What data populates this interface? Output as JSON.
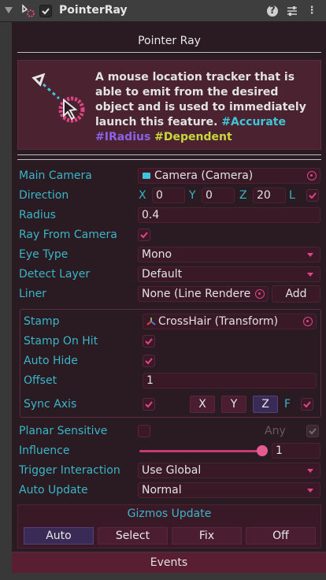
{
  "header": {
    "title": "PointerRay"
  },
  "panel_title": "Pointer Ray",
  "description": {
    "text": "A mouse location tracker that is able to emit from the desired object and is used to immediately launch this feature.",
    "tag_accurate": "#Accurate",
    "tag_iradius": "#IRadius",
    "tag_dependent": "#Dependent"
  },
  "fields": {
    "main_camera": {
      "label": "Main Camera",
      "value": "Camera (Camera)"
    },
    "direction": {
      "label": "Direction",
      "x_label": "X",
      "x": "0",
      "y_label": "Y",
      "y": "0",
      "z_label": "Z",
      "z": "20",
      "l_label": "L"
    },
    "radius": {
      "label": "Radius",
      "value": "0.4"
    },
    "ray_from_camera": {
      "label": "Ray From Camera"
    },
    "eye_type": {
      "label": "Eye Type",
      "value": "Mono"
    },
    "detect_layer": {
      "label": "Detect Layer",
      "value": "Default"
    },
    "liner": {
      "label": "Liner",
      "value": "None (Line Rendere",
      "add_label": "Add"
    },
    "stamp": {
      "label": "Stamp",
      "value": "CrossHair (Transform)"
    },
    "stamp_on_hit": {
      "label": "Stamp On Hit"
    },
    "auto_hide": {
      "label": "Auto Hide"
    },
    "offset": {
      "label": "Offset",
      "value": "1"
    },
    "sync_axis": {
      "label": "Sync Axis",
      "x": "X",
      "y": "Y",
      "z": "Z",
      "f": "F"
    },
    "planar_sensitive": {
      "label": "Planar Sensitive",
      "any_label": "Any"
    },
    "influence": {
      "label": "Influence",
      "value": "1",
      "slider_fraction": 1.0
    },
    "trigger_interaction": {
      "label": "Trigger Interaction",
      "value": "Use Global"
    },
    "auto_update": {
      "label": "Auto Update",
      "value": "Normal"
    }
  },
  "gizmos": {
    "title": "Gizmos Update",
    "options": [
      "Auto",
      "Select",
      "Fix",
      "Off"
    ],
    "selected": "Auto"
  },
  "events_label": "Events",
  "colors": {
    "label": "#39b6c9",
    "accent": "#e04585",
    "field_bg": "#3a1926"
  }
}
